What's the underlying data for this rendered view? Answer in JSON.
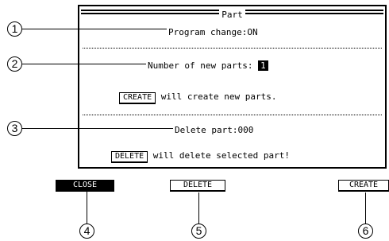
{
  "screen": {
    "title": "Part",
    "program_change_label": "Program change",
    "program_change_value": "ON",
    "new_parts_label": "Number of new parts",
    "new_parts_value": "1",
    "create_key": "CREATE",
    "create_text": "will create new parts.",
    "delete_part_label": "Delete part",
    "delete_part_value": "000",
    "delete_key": "DELETE",
    "delete_text": "will delete selected part!"
  },
  "function_keys": [
    {
      "label": "CLOSE"
    },
    {
      "label": "DELETE"
    },
    {
      "label": "CREATE"
    }
  ],
  "callouts": [
    "1",
    "2",
    "3",
    "4",
    "5",
    "6"
  ]
}
